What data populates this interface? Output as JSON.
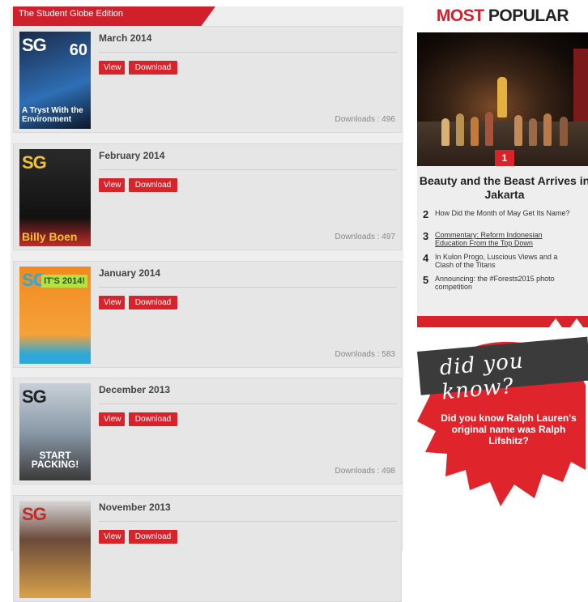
{
  "banner": {
    "label": "The Student Globe Edition"
  },
  "editions": [
    {
      "title": "March 2014",
      "view_label": "View",
      "download_label": "Download",
      "downloads": "Downloads : 496",
      "cover": {
        "brand": "SG",
        "badge": "60",
        "headline": "A Tryst With the Environment",
        "bg": "#1a2a4a",
        "accent": "#2e6fb5"
      }
    },
    {
      "title": "February 2014",
      "view_label": "View",
      "download_label": "Download",
      "downloads": "Downloads : 497",
      "cover": {
        "brand": "SG",
        "badge": "",
        "headline": "Billy Boen",
        "bg": "#1b1b1b",
        "accent": "#c42a2a"
      }
    },
    {
      "title": "January 2014",
      "view_label": "View",
      "download_label": "Download",
      "downloads": "Downloads : 583",
      "cover": {
        "brand": "SG",
        "badge": "IT'S 2014!",
        "headline": "",
        "bg": "#f08a1e",
        "accent": "#2ea8d8"
      }
    },
    {
      "title": "December 2013",
      "view_label": "View",
      "download_label": "Download",
      "downloads": "Downloads : 498",
      "cover": {
        "brand": "SG",
        "badge": "",
        "headline": "START PACKING!",
        "bg": "#8a9aa8",
        "accent": "#c02a2a"
      }
    },
    {
      "title": "November 2013",
      "view_label": "View",
      "download_label": "Download",
      "downloads": "",
      "cover": {
        "brand": "SG",
        "badge": "",
        "headline": "",
        "bg": "#6b4a3a",
        "accent": "#d8a24a"
      }
    }
  ],
  "most_popular": {
    "title_part1": "MOST",
    "title_part2": " POPULAR",
    "featured_rank": "1",
    "featured_headline": "Beauty and the Beast Arrives in Jakarta",
    "items": [
      {
        "rank": "2",
        "text": "How Did the Month of May Get Its Name?"
      },
      {
        "rank": "3",
        "text": "Commentary: Reform Indonesian Education From the Top Down"
      },
      {
        "rank": "4",
        "text": "In Kulon Progo, Luscious Views and a Clash of the Titans"
      },
      {
        "rank": "5",
        "text": "Announcing: the #Forests2015 photo competition"
      }
    ]
  },
  "did_you_know": {
    "tag": "did you know?",
    "text": "Did you know Ralph Lauren's original name was Ralph Lifshitz?"
  },
  "colors": {
    "brand_red": "#d8232a",
    "panel_grey": "#eeeeee",
    "tag_dark": "#3b3b3b"
  }
}
